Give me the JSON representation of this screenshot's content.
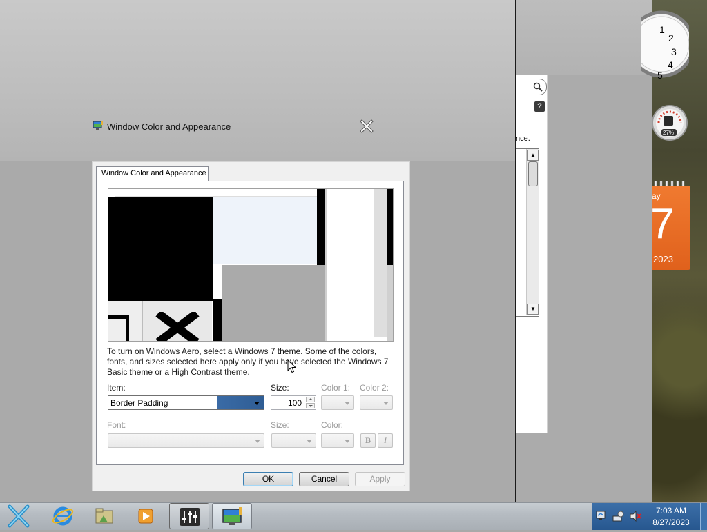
{
  "dialog": {
    "window_title": "Window Color and Appearance",
    "tab_label": "Window Color and Appearance",
    "description": "To turn on Windows Aero, select a Windows 7 theme.  Some of the colors, fonts, and sizes selected here apply only if you have selected the Windows 7 Basic theme or a High Contrast theme.",
    "item_label": "Item:",
    "item_value": "Border Padding",
    "size_label": "Size:",
    "size_value": "100",
    "color1_label": "Color 1:",
    "color2_label": "Color 2:",
    "font_label": "Font:",
    "font_size_label": "Size:",
    "font_color_label": "Color:",
    "bold_label": "B",
    "italic_label": "I",
    "ok_label": "OK",
    "cancel_label": "Cancel",
    "apply_label": "Apply"
  },
  "background_window": {
    "partial_text": "nce."
  },
  "gadgets": {
    "clock_numbers": [
      "1",
      "2",
      "3",
      "4",
      "5"
    ],
    "meter_percent": "27%",
    "calendar_day_suffix": "ay",
    "calendar_day": "7",
    "calendar_year": "2023"
  },
  "taskbar": {
    "time": "7:03 AM",
    "date": "8/27/2023",
    "items": [
      "start-button",
      "internet-explorer",
      "file-explorer",
      "media-player",
      "mixer-app",
      "display-settings"
    ]
  },
  "colors": {
    "tray_bg": "#2d5f97",
    "item_select_highlight": "#3a6ba6",
    "calendar_orange": "#e56a22"
  }
}
